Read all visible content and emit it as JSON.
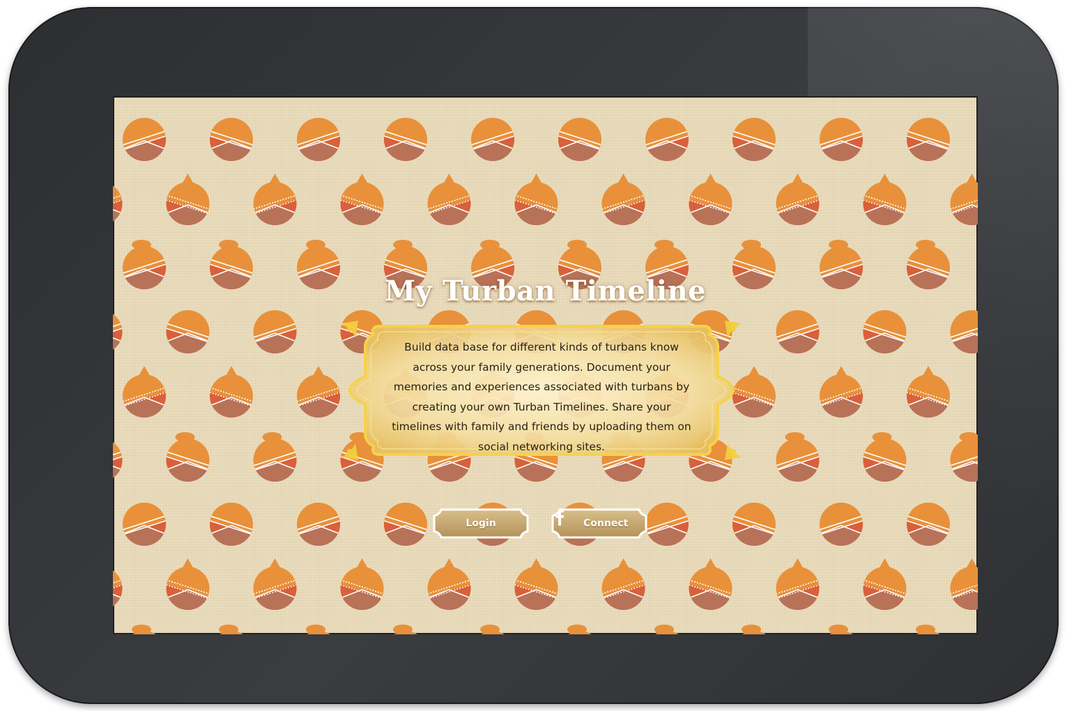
{
  "app": {
    "title": "My Turban Timeline",
    "description": "Build data base for different kinds of turbans know across your family generations. Document your memories and experiences associated with turbans by creating your own Turban Timelines. Share your timelines with family and friends by uploading them on social networking sites.",
    "login_label": "Login",
    "connect_label": "Connect",
    "connect_icon": "facebook-icon"
  },
  "colors": {
    "background": "#e9dcbd",
    "turban_orange": "#e8913a",
    "turban_red": "#d9603a",
    "face_brown": "#b87258",
    "plaque_gold": "#f2cd5a",
    "tablet_frame": "#333538"
  }
}
